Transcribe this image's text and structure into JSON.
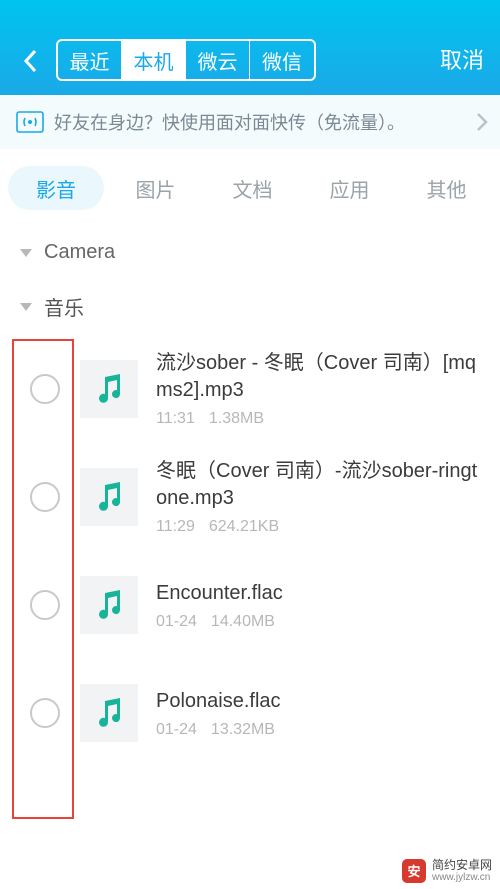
{
  "header": {
    "tabs": [
      "最近",
      "本机",
      "微云",
      "微信"
    ],
    "active_index": 1,
    "cancel": "取消"
  },
  "banner": {
    "text": "好友在身边？快使用面对面快传（免流量）。"
  },
  "category_tabs": {
    "items": [
      "影音",
      "图片",
      "文档",
      "应用",
      "其他"
    ],
    "active_index": 0
  },
  "sections": [
    {
      "title": "Camera",
      "kind": "camera"
    },
    {
      "title": "音乐",
      "kind": "music"
    }
  ],
  "files": [
    {
      "name": "流沙sober - 冬眠（Cover 司南）[mqms2].mp3",
      "time": "11:31",
      "size": "1.38MB"
    },
    {
      "name": "冬眠（Cover 司南）-流沙sober-ringtone.mp3",
      "time": "11:29",
      "size": "624.21KB"
    },
    {
      "name": "Encounter.flac",
      "time": "01-24",
      "size": "14.40MB"
    },
    {
      "name": "Polonaise.flac",
      "time": "01-24",
      "size": "13.32MB"
    }
  ],
  "watermark": {
    "brand": "简约安卓网",
    "url": "www.jylzw.cn"
  }
}
